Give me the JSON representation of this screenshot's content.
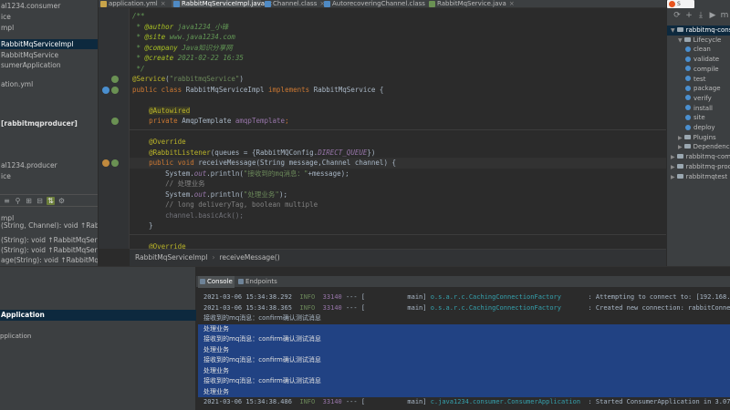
{
  "project_tree": {
    "items": [
      {
        "label": "al1234.consumer"
      },
      {
        "label": "ice"
      },
      {
        "label": "mpl"
      },
      {
        "label": "RabbitMqServiceImpl",
        "selected": true
      },
      {
        "label": "RabbitMqService"
      },
      {
        "label": "sumerApplication"
      },
      {
        "label": "ation.yml"
      },
      {
        "label": "[rabbitmqproducer]",
        "bold": true
      },
      {
        "label": "al1234.producer"
      },
      {
        "label": "ice"
      },
      {
        "label": "mpl"
      },
      {
        "label": "(String, Channel): void ↑RabbitMqService"
      },
      {
        "label": "(String): void ↑RabbitMqService"
      },
      {
        "label": "(String): void ↑RabbitMqService"
      },
      {
        "label": "age(String): void ↑RabbitMqService"
      }
    ]
  },
  "tabs": [
    {
      "label": "application.yml",
      "color": "#c8a44a",
      "active": false
    },
    {
      "label": "RabbitMqServiceImpl.java",
      "color": "#4f8ac4",
      "active": true
    },
    {
      "label": "Channel.class",
      "color": "#4f8ac4",
      "active": false
    },
    {
      "label": "AutorecoveringChannel.class",
      "color": "#4f8ac4",
      "active": false
    },
    {
      "label": "RabbitMqService.java",
      "color": "#6a9153",
      "active": false
    }
  ],
  "code_lines": [
    [
      {
        "t": "/**",
        "c": "c-doc"
      }
    ],
    [
      {
        "t": " * ",
        "c": "c-doc"
      },
      {
        "t": "@author ",
        "c": "c-doctag"
      },
      {
        "t": "java1234_小锋",
        "c": "c-doc"
      }
    ],
    [
      {
        "t": " * ",
        "c": "c-doc"
      },
      {
        "t": "@site ",
        "c": "c-doctag"
      },
      {
        "t": "www.java1234.com",
        "c": "c-doc"
      }
    ],
    [
      {
        "t": " * ",
        "c": "c-doc"
      },
      {
        "t": "@company ",
        "c": "c-doctag"
      },
      {
        "t": "Java知识分享网",
        "c": "c-doc"
      }
    ],
    [
      {
        "t": " * ",
        "c": "c-doc"
      },
      {
        "t": "@create ",
        "c": "c-doctag"
      },
      {
        "t": "2021-02-22 16:35",
        "c": "c-doc"
      }
    ],
    [
      {
        "t": " */",
        "c": "c-doc"
      }
    ],
    [
      {
        "t": "@Service",
        "c": "c-ann"
      },
      {
        "t": "(",
        "c": "c-id"
      },
      {
        "t": "\"rabbitmqService\"",
        "c": "c-str"
      },
      {
        "t": ")",
        "c": "c-id"
      }
    ],
    [
      {
        "t": "public class ",
        "c": "c-kw"
      },
      {
        "t": "RabbitMqServiceImpl ",
        "c": "c-id"
      },
      {
        "t": "implements ",
        "c": "c-kw"
      },
      {
        "t": "RabbitMqService {",
        "c": "c-id"
      }
    ],
    [],
    [
      {
        "t": "    ",
        "c": "c-id"
      },
      {
        "t": "@Autowired",
        "c": "c-ann"
      }
    ],
    [
      {
        "t": "    ",
        "c": "c-id"
      },
      {
        "t": "private ",
        "c": "c-kw"
      },
      {
        "t": "AmqpTemplate ",
        "c": "c-id"
      },
      {
        "t": "amqpTemplate",
        "c": "c-field"
      },
      {
        "t": ";",
        "c": "c-kw"
      }
    ],
    [],
    [
      {
        "t": "    ",
        "c": "c-id"
      },
      {
        "t": "@Override",
        "c": "c-ann"
      }
    ],
    [
      {
        "t": "    ",
        "c": "c-id"
      },
      {
        "t": "@RabbitListener",
        "c": "c-ann"
      },
      {
        "t": "(queues = {RabbitMQConfig.",
        "c": "c-id"
      },
      {
        "t": "DIRECT_QUEUE",
        "c": "c-static"
      },
      {
        "t": "})",
        "c": "c-id"
      }
    ],
    [
      {
        "t": "    ",
        "c": "c-id"
      },
      {
        "t": "public void ",
        "c": "c-kw"
      },
      {
        "t": "receiveMessage(String message,Channel channel) {",
        "c": "c-id"
      }
    ],
    [
      {
        "t": "        System.",
        "c": "c-id"
      },
      {
        "t": "out",
        "c": "c-static"
      },
      {
        "t": ".println(",
        "c": "c-id"
      },
      {
        "t": "\"接收到的mq消息：\"",
        "c": "c-str"
      },
      {
        "t": "+message);",
        "c": "c-id"
      }
    ],
    [
      {
        "t": "        // 处理业务",
        "c": "c-cmt"
      }
    ],
    [
      {
        "t": "        System.",
        "c": "c-id"
      },
      {
        "t": "out",
        "c": "c-static"
      },
      {
        "t": ".println(",
        "c": "c-id"
      },
      {
        "t": "\"处理业务\"",
        "c": "c-str"
      },
      {
        "t": ");",
        "c": "c-id"
      }
    ],
    [
      {
        "t": "        // long deliveryTag, boolean multiple",
        "c": "c-cmt"
      }
    ],
    [
      {
        "t": "        channel.basicAck();",
        "c": "c-unused"
      }
    ],
    [
      {
        "t": "    }",
        "c": "c-id"
      }
    ],
    [],
    [
      {
        "t": "    ",
        "c": "c-id"
      },
      {
        "t": "@Override",
        "c": "c-ann"
      }
    ]
  ],
  "breadcrumb": {
    "class": "RabbitMqServiceImpl",
    "method": "receiveMessage()"
  },
  "maven": {
    "logo_text": "S",
    "items": [
      {
        "label": "rabbitmq-consumer",
        "kind": "root",
        "indent": 0,
        "selected": true
      },
      {
        "label": "Lifecycle",
        "kind": "folder",
        "indent": 1
      },
      {
        "label": "clean",
        "kind": "goal",
        "indent": 2
      },
      {
        "label": "validate",
        "kind": "goal",
        "indent": 2
      },
      {
        "label": "compile",
        "kind": "goal",
        "indent": 2
      },
      {
        "label": "test",
        "kind": "goal",
        "indent": 2
      },
      {
        "label": "package",
        "kind": "goal",
        "indent": 2
      },
      {
        "label": "verify",
        "kind": "goal",
        "indent": 2
      },
      {
        "label": "install",
        "kind": "goal",
        "indent": 2
      },
      {
        "label": "site",
        "kind": "goal",
        "indent": 2
      },
      {
        "label": "deploy",
        "kind": "goal",
        "indent": 2
      },
      {
        "label": "Plugins",
        "kind": "folder",
        "indent": 1
      },
      {
        "label": "Dependencies",
        "kind": "folder",
        "indent": 1
      },
      {
        "label": "rabbitmq-common",
        "kind": "root",
        "indent": 0
      },
      {
        "label": "rabbitmq-producer",
        "kind": "root",
        "indent": 0
      },
      {
        "label": "rabbitmqtest",
        "kind": "root",
        "indent": 0
      }
    ]
  },
  "run_panel": {
    "app_label": "Application",
    "app_label2": "pplication",
    "tabs": [
      {
        "label": "Console",
        "active": true
      },
      {
        "label": "Endpoints",
        "active": false
      }
    ],
    "console_lines": [
      {
        "ts": "2021-03-06 15:34:38.292",
        "level": "INFO",
        "pid": "33140",
        "rest": " --- [           main] ",
        "logger": "o.s.a.r.c.CachingConnectionFactory      ",
        "msg": " : Attempting to connect to: [192.168.0.",
        "selected": false
      },
      {
        "ts": "2021-03-06 15:34:38.365",
        "level": "INFO",
        "pid": "33140",
        "rest": " --- [           main] ",
        "logger": "o.s.a.r.c.CachingConnectionFactory      ",
        "msg": " : Created new connection: rabbitConnecti",
        "selected": false
      },
      {
        "text": "接收到的mq消息：confirm确认测试消息",
        "selected": false
      },
      {
        "text": "处理业务",
        "selected": true
      },
      {
        "text": "接收到的mq消息：confirm确认测试消息",
        "selected": true
      },
      {
        "text": "处理业务",
        "selected": true
      },
      {
        "text": "接收到的mq消息：confirm确认测试消息",
        "selected": true
      },
      {
        "text": "处理业务",
        "selected": true
      },
      {
        "text": "接收到的mq消息：confirm确认测试消息",
        "selected": true
      },
      {
        "text": "处理业务",
        "selected": true
      },
      {
        "ts": "2021-03-06 15:34:38.486",
        "level": "INFO",
        "pid": "33140",
        "rest": " --- [           main] ",
        "logger": "c.java1234.consumer.ConsumerApplication ",
        "msg": " : Started ConsumerApplication in 3.075 s",
        "selected": false
      }
    ]
  }
}
